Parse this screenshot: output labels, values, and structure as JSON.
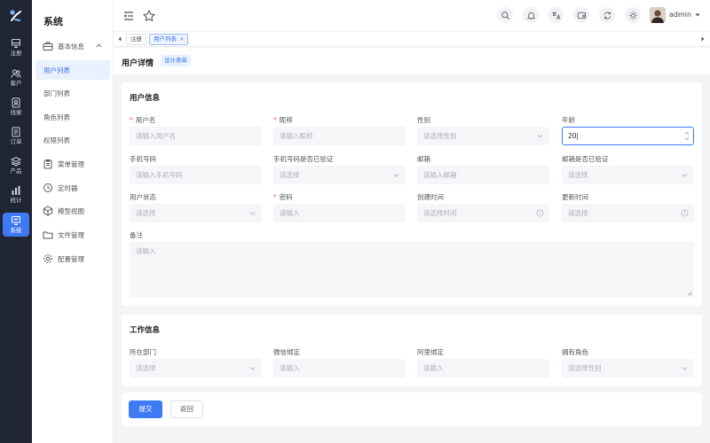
{
  "rail": [
    {
      "label": "注册",
      "icon": "monitor-icon"
    },
    {
      "label": "客户",
      "icon": "users-icon"
    },
    {
      "label": "线索",
      "icon": "badge-icon"
    },
    {
      "label": "订单",
      "icon": "document-icon"
    },
    {
      "label": "产品",
      "icon": "layers-icon"
    },
    {
      "label": "统计",
      "icon": "bar-chart-icon"
    },
    {
      "label": "系统",
      "icon": "screen-icon"
    }
  ],
  "submenu": {
    "title": "系统",
    "group": "基本信息",
    "children": [
      "用户列表",
      "部门列表",
      "角色列表",
      "权限列表"
    ],
    "items": [
      "菜单管理",
      "定时器",
      "模型视图",
      "文件管理",
      "配置管理"
    ]
  },
  "header": {
    "username": "admin"
  },
  "tabs": [
    {
      "label": "注册"
    },
    {
      "label": "用户列表"
    }
  ],
  "page": {
    "title": "用户详情",
    "tag": "设计表单"
  },
  "user_info": {
    "title": "用户信息",
    "fields": [
      {
        "label": "用户名",
        "placeholder": "请输入用户名"
      },
      {
        "label": "昵称",
        "placeholder": "请输入昵称"
      },
      {
        "label": "性别",
        "placeholder": "请选择性别"
      },
      {
        "label": "年龄",
        "value": "20"
      },
      {
        "label": "手机号码",
        "placeholder": "请输入手机号码"
      },
      {
        "label": "手机号码是否已验证",
        "placeholder": "请选择"
      },
      {
        "label": "邮箱",
        "placeholder": "请输入邮箱"
      },
      {
        "label": "邮箱是否已验证",
        "placeholder": "请选择"
      },
      {
        "label": "用户状态",
        "placeholder": "请选择"
      },
      {
        "label": "密码",
        "placeholder": "请输入"
      },
      {
        "label": "创建时间",
        "placeholder": "请选择时间"
      },
      {
        "label": "更新时间",
        "placeholder": "请选择"
      }
    ],
    "remark_label": "备注",
    "remark_placeholder": "请输入"
  },
  "work_info": {
    "title": "工作信息",
    "fields": [
      {
        "label": "所在部门",
        "placeholder": "请选择"
      },
      {
        "label": "微信绑定",
        "placeholder": "请输入"
      },
      {
        "label": "阿里绑定",
        "placeholder": "请输入"
      },
      {
        "label": "拥有角色",
        "placeholder": "请选择性别"
      }
    ]
  },
  "actions": {
    "submit": "提交",
    "back": "返回"
  },
  "colors": {
    "primary": "#3f7af5",
    "rail_bg": "#1f2533",
    "required": "#f56c6c"
  }
}
